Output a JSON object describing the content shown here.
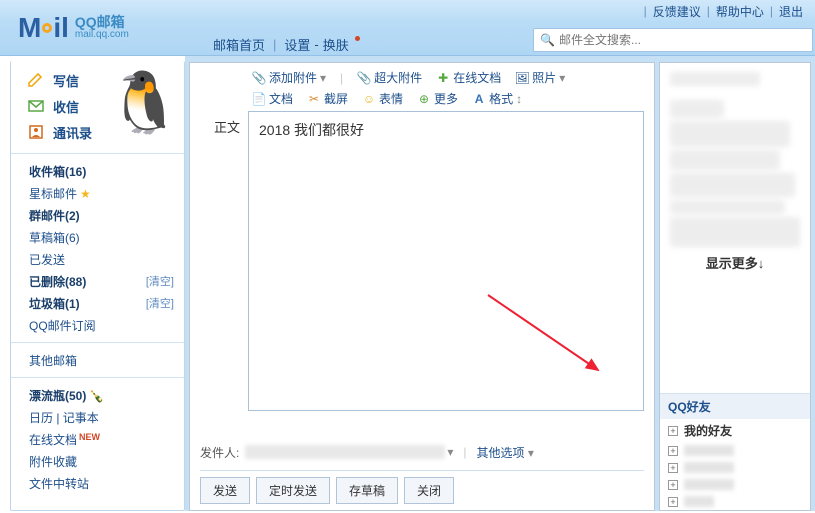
{
  "header": {
    "logo_cn": "QQ邮箱",
    "logo_en": "mail.qq.com",
    "top_links": {
      "feedback": "反馈建议",
      "help": "帮助中心",
      "exit": "退出"
    },
    "nav": {
      "home": "邮箱首页",
      "settings": "设置",
      "skin": "换肤"
    },
    "search_placeholder": "邮件全文搜索..."
  },
  "sidebar": {
    "write": "写信",
    "receive": "收信",
    "contacts": "通讯录",
    "folders": {
      "inbox": "收件箱(16)",
      "star": "星标邮件",
      "group": "群邮件(2)",
      "draft": "草稿箱(6)",
      "sent": "已发送",
      "trash": "已删除(88)",
      "spam": "垃圾箱(1)",
      "sub": "QQ邮件订阅",
      "other": "其他邮箱",
      "bottle": "漂流瓶(50)",
      "cal": "日历 | 记事本",
      "online": "在线文档",
      "attach": "附件收藏",
      "transfer": "文件中转站"
    },
    "clear": "[清空]",
    "new_tag": "NEW"
  },
  "compose": {
    "toolbar": {
      "attach": "添加附件",
      "big_attach": "超大附件",
      "online_doc": "在线文档",
      "photo": "照片",
      "doc": "文档",
      "screenshot": "截屏",
      "emoji": "表情",
      "more": "更多",
      "format": "格式"
    },
    "body_label": "正文",
    "body_text": "2018 我们都很好",
    "sender_label": "发件人:",
    "other_options": "其他选项",
    "actions": {
      "send": "发送",
      "schedule": "定时发送",
      "draft": "存草稿",
      "close": "关闭"
    }
  },
  "contacts": {
    "show_more": "显示更多↓",
    "qq_friends": "QQ好友",
    "my_friends": "我的好友"
  }
}
